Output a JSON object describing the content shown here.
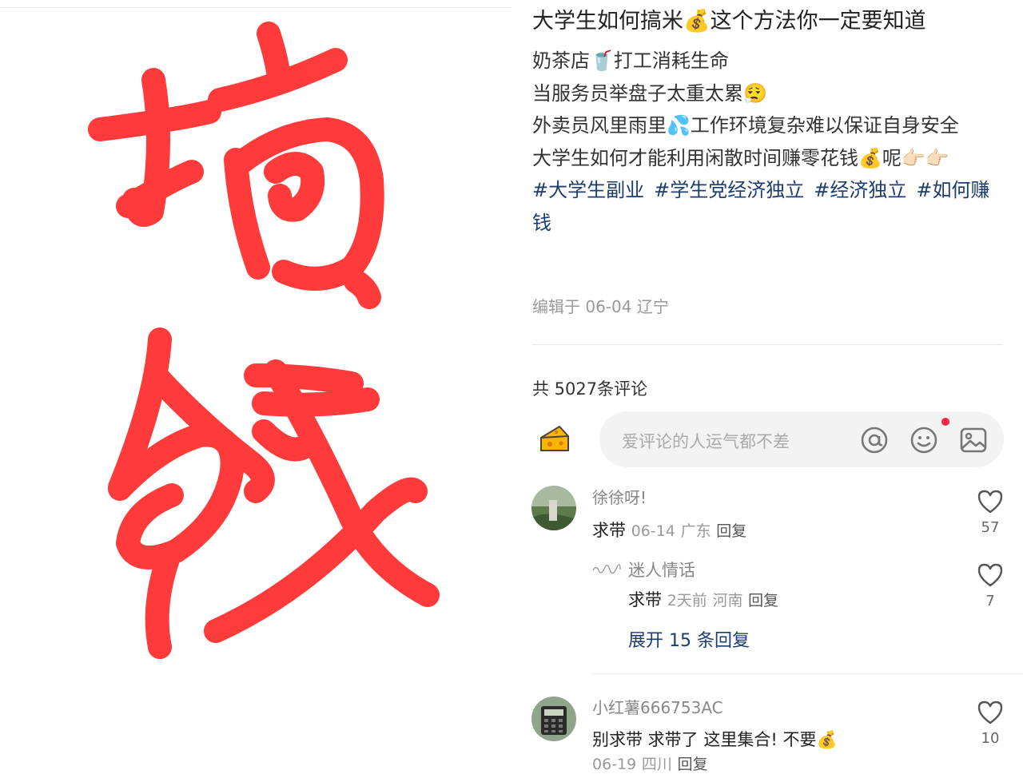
{
  "post": {
    "title": "大学生如何搞米💰这个方法你一定要知道",
    "lines": [
      "奶茶店🥤打工消耗生命",
      "当服务员举盘子太重太累😮‍💨",
      "外卖员风里雨里💦工作环境复杂难以保证自身安全",
      "大学生如何才能利用闲散时间赚零花钱💰呢👉🏻👉🏻"
    ],
    "tags": [
      "#大学生副业",
      "#学生党经济独立",
      "#经济独立",
      "#如何赚钱"
    ],
    "meta": "编辑于 06-04 辽宁"
  },
  "image": {
    "characters": "搞钱"
  },
  "comments_header": "共 5027条评论",
  "input": {
    "placeholder": "爱评论的人运气都不差",
    "icons": [
      "at-icon",
      "emoji-icon",
      "image-icon"
    ]
  },
  "comments": [
    {
      "user": "徐徐呀!",
      "text": "求带",
      "date": "06-14",
      "location": "广东",
      "reply": "回复",
      "likes": "57"
    },
    {
      "user": "迷人情话",
      "text": "求带",
      "date": "2天前",
      "location": "河南",
      "reply": "回复",
      "likes": "7"
    },
    {
      "user": "小红薯666753AC",
      "text": "别求带 求带了 这里集合! 不要💰",
      "date": "06-19",
      "location": "四川",
      "reply": "回复",
      "likes": "10"
    }
  ],
  "expand_label": "展开 15 条回复",
  "colors": {
    "accent": "#ff2442",
    "link": "#1c3d70",
    "calligraphy": "#ff2a2a"
  }
}
